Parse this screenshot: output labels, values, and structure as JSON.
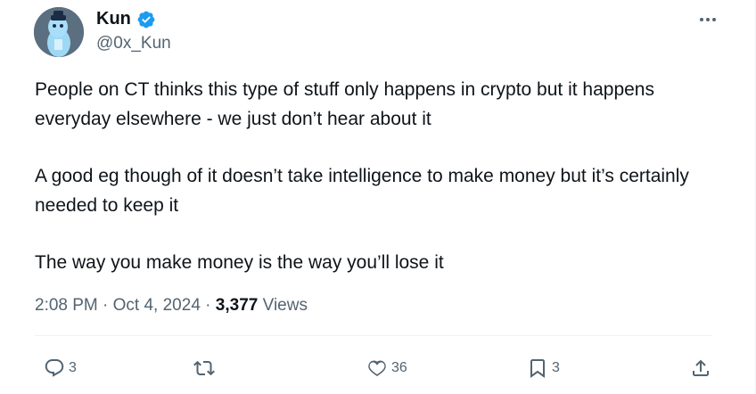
{
  "author": {
    "name": "Kun",
    "handle": "@0x_Kun",
    "avatar_icon": "blue-cartoon-avatar-icon"
  },
  "tweet": {
    "paragraphs": [
      "People on CT thinks this type of stuff only happens in crypto but it happens everyday elsewhere - we just don’t hear about it",
      "A good eg though of it doesn’t take intelligence to make money but it’s certainly needed to keep it",
      "The way you make money is the way you’ll lose it"
    ],
    "time": "2:08 PM",
    "separator": "·",
    "date": "Oct 4, 2024",
    "views_count": "3,377",
    "views_label": "Views"
  },
  "actions": {
    "replies": "3",
    "retweets": "",
    "likes": "36",
    "bookmarks": "3"
  },
  "colors": {
    "text": "#0f1419",
    "secondary": "#536471",
    "verified_blue": "#1d9bf0"
  }
}
